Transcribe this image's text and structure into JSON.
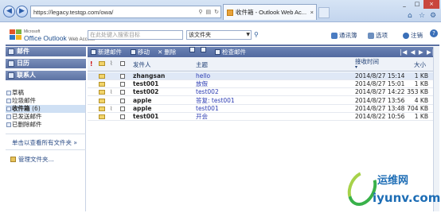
{
  "browser": {
    "url": "https://legacy.testqp.com/owa/",
    "tab_title": "收件箱 - Outlook Web Ac...",
    "tab_close": "×",
    "new_tab": "",
    "window_controls": [
      "_",
      "□",
      "×"
    ],
    "tools_icons": [
      "home-icon",
      "star-icon",
      "gear-icon"
    ]
  },
  "owa": {
    "brand_ms": "Microsoft",
    "brand_product": "Office Outlook",
    "brand_suffix": "Web Access",
    "search_placeholder": "在此处键入搜索目标",
    "search_scope": "该文件夹",
    "top_links": [
      {
        "label": "通讯簿",
        "color": "#4a7cc2"
      },
      {
        "label": "选项",
        "color": "#6c8fbf"
      },
      {
        "label": "注销",
        "color": "#3a6fb8"
      }
    ],
    "help_glyph": "?"
  },
  "nav": {
    "headers": [
      {
        "label": "邮件"
      },
      {
        "label": "日历"
      },
      {
        "label": "联系人"
      }
    ],
    "folders": [
      {
        "label": "草稿",
        "count": "",
        "selected": false
      },
      {
        "label": "垃圾邮件",
        "count": "",
        "selected": false
      },
      {
        "label": "收件箱",
        "count": "(6)",
        "selected": true
      },
      {
        "label": "已发送邮件",
        "count": "",
        "selected": false
      },
      {
        "label": "已删除邮件",
        "count": "",
        "selected": false
      }
    ],
    "view_all": "单击以查看所有文件夹",
    "view_all_arrow": "»",
    "manage": "管理文件夹..."
  },
  "toolbar": {
    "new_mail": "新建邮件",
    "move": "移动",
    "delete": "删除",
    "check": "检查邮件",
    "pager": "|◀ ◀ ▶ ▶|"
  },
  "columns": {
    "flag": "!",
    "from": "发件人",
    "subject": "主题",
    "received": "接收时间",
    "received_sort": "▾",
    "size": "大小"
  },
  "emails": [
    {
      "from": "zhangsan",
      "subject": "hello",
      "date": "2014/8/27 15:14",
      "size": "1 KB",
      "attach": false,
      "unread": true
    },
    {
      "from": "test001",
      "subject": "放假",
      "date": "2014/8/27 15:01",
      "size": "1 KB",
      "attach": false,
      "unread": false
    },
    {
      "from": "test002",
      "subject": "test002",
      "date": "2014/8/27 14:22",
      "size": "353 KB",
      "attach": true,
      "unread": false
    },
    {
      "from": "apple",
      "subject": "答复: test001",
      "date": "2014/8/27 13:56",
      "size": "4 KB",
      "attach": false,
      "unread": false
    },
    {
      "from": "apple",
      "subject": "test001",
      "date": "2014/8/27 13:48",
      "size": "704 KB",
      "attach": true,
      "unread": false
    },
    {
      "from": "test001",
      "subject": "开会",
      "date": "2014/8/22 10:56",
      "size": "1 KB",
      "attach": false,
      "unread": false
    }
  ],
  "watermark": {
    "title": "运维网",
    "site": "iyunv.com"
  }
}
